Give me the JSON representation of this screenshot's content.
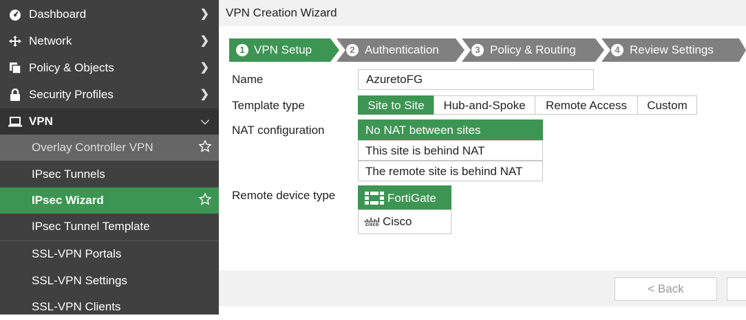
{
  "sidebar": {
    "nav": [
      {
        "label": "Dashboard",
        "icon": "dashboard-icon"
      },
      {
        "label": "Network",
        "icon": "network-icon"
      },
      {
        "label": "Policy & Objects",
        "icon": "policy-icon"
      },
      {
        "label": "Security Profiles",
        "icon": "lock-icon"
      },
      {
        "label": "VPN",
        "icon": "laptop-icon"
      }
    ],
    "vpn_items": [
      {
        "label": "Overlay Controller VPN"
      },
      {
        "label": "IPsec Tunnels"
      },
      {
        "label": "IPsec Wizard"
      },
      {
        "label": "IPsec Tunnel Template"
      },
      {
        "label": "SSL-VPN Portals"
      },
      {
        "label": "SSL-VPN Settings"
      },
      {
        "label": "SSL-VPN Clients"
      }
    ]
  },
  "header": {
    "title": "VPN Creation Wizard"
  },
  "steps": [
    {
      "num": "1",
      "label": "VPN Setup"
    },
    {
      "num": "2",
      "label": "Authentication"
    },
    {
      "num": "3",
      "label": "Policy & Routing"
    },
    {
      "num": "4",
      "label": "Review Settings"
    }
  ],
  "form": {
    "name_label": "Name",
    "name_value": "AzuretoFG",
    "template_label": "Template type",
    "template_options": [
      "Site to Site",
      "Hub-and-Spoke",
      "Remote Access",
      "Custom"
    ],
    "nat_label": "NAT configuration",
    "nat_options": [
      "No NAT between sites",
      "This site is behind NAT",
      "The remote site is behind NAT"
    ],
    "device_label": "Remote device type",
    "device_options": [
      "FortiGate",
      "Cisco"
    ],
    "cisco_logo_text": "cisco"
  },
  "footer": {
    "back_label": "< Back"
  },
  "colors": {
    "sidebar": "#404040",
    "accent": "#3d9553",
    "hover": "#666666",
    "step_inactive": "#808080"
  }
}
